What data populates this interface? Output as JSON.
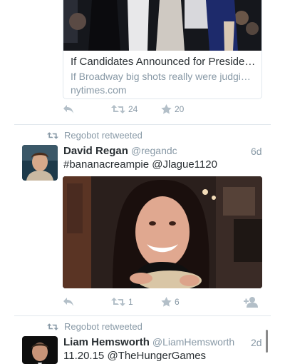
{
  "tweet1": {
    "card_title": "If Candidates Announced for Preside…",
    "card_description": "If Broadway big shots really were judgi…",
    "card_domain": "nytimes.com",
    "retweets": "24",
    "favorites": "20"
  },
  "tweet2": {
    "retweeted_by": "Regobot retweeted",
    "name": "David Regan",
    "handle": "@regandc",
    "time": "6d",
    "text": "#bananacreampie @Jlague1120",
    "retweets": "1",
    "favorites": "6"
  },
  "tweet3": {
    "retweeted_by": "Regobot retweeted",
    "name": "Liam Hemsworth",
    "handle": "@LiamHemsworth",
    "time": "2d",
    "text": "11.20.15 @TheHungerGames"
  },
  "icons": {
    "reply": "reply-icon",
    "retweet": "retweet-icon",
    "favorite": "star-icon",
    "follow": "follow-icon"
  },
  "colors": {
    "muted": "#8899a6",
    "text": "#292f33",
    "divider": "#e1e8ed"
  }
}
